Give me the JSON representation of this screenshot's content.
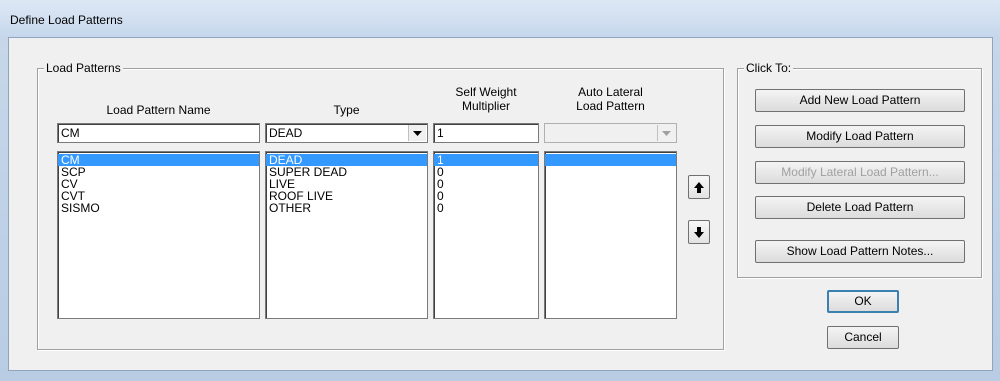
{
  "window": {
    "title": "Define Load Patterns"
  },
  "load_patterns_group": {
    "label": "Load Patterns",
    "headers": {
      "name": "Load Pattern Name",
      "type": "Type",
      "self_weight_line1": "Self Weight",
      "self_weight_line2": "Multiplier",
      "auto_lateral_line1": "Auto Lateral",
      "auto_lateral_line2": "Load Pattern"
    },
    "edit_row": {
      "name": "CM",
      "type": "DEAD",
      "multiplier": "1",
      "auto_lateral": ""
    },
    "names": [
      "CM",
      "SCP",
      "CV",
      "CVT",
      "SISMO"
    ],
    "types": [
      "DEAD",
      "SUPER DEAD",
      "LIVE",
      "ROOF LIVE",
      "OTHER"
    ],
    "multipliers": [
      "1",
      "0",
      "0",
      "0",
      "0"
    ],
    "selected_index": 0
  },
  "click_to_group": {
    "label": "Click To:",
    "add": "Add New Load Pattern",
    "modify": "Modify Load Pattern",
    "modify_lateral": "Modify Lateral Load Pattern...",
    "delete": "Delete Load Pattern",
    "notes": "Show Load Pattern Notes..."
  },
  "buttons": {
    "ok": "OK",
    "cancel": "Cancel"
  },
  "icons": {
    "move_up": "arrow-up-icon",
    "move_down": "arrow-down-icon",
    "dropdown": "chevron-down-icon"
  },
  "colors": {
    "selection": "#3399ff",
    "default_button_border": "#3c7fb1"
  }
}
